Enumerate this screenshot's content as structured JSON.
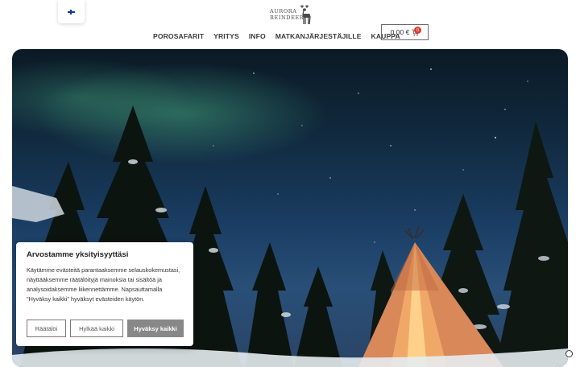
{
  "header": {
    "language_flag": "finnish-flag-icon",
    "logo": {
      "line1": "AURORA",
      "line2": "REINDEER",
      "icon": "reindeer-icon"
    },
    "nav": [
      {
        "label": "POROSAFARIT"
      },
      {
        "label": "YRITYS"
      },
      {
        "label": "INFO"
      },
      {
        "label": "MATKANJÄRJESTÄJILLE"
      },
      {
        "label": "KAUPPA"
      }
    ],
    "cart": {
      "amount": "0,00 €",
      "count": "0",
      "icon": "cart-icon"
    }
  },
  "hero": {
    "scene": "northern-lights-teepee-forest"
  },
  "cookie": {
    "title": "Arvostamme yksityisyyttäsi",
    "body": "Käytämme evästeitä parantaaksemme selauskokemustasi, näyttääksemme räätälöityjä mainoksia tai sisältöä ja analysoidaksemme liikennettämme. Napsauttamalla \"Hyväksy kaikki\" hyväksyt evästeiden käytön.",
    "buttons": {
      "customize": "Räätälöi",
      "reject": "Hylkää kaikki",
      "accept": "Hyväksy kaikki"
    }
  },
  "colors": {
    "accent_button": "#888888",
    "badge": "#d8412f",
    "sky_top": "#0b1a25",
    "aurora": "#50be8c"
  }
}
